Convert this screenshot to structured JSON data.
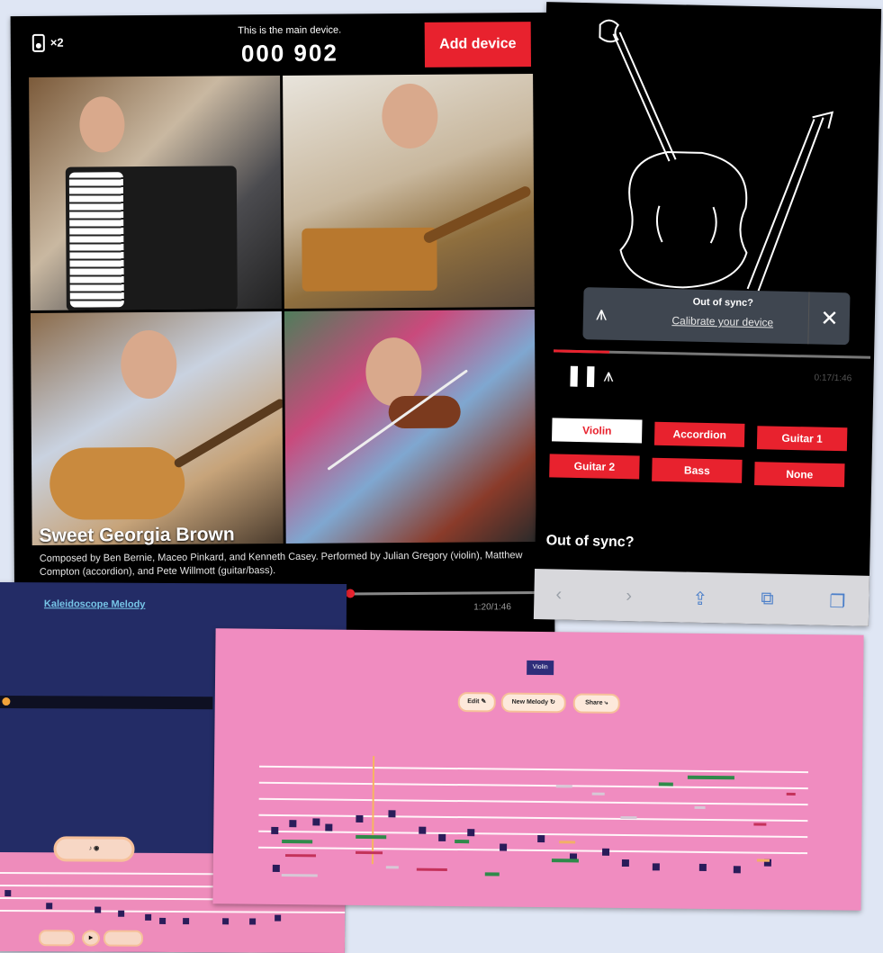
{
  "tablet": {
    "speaker_count": "×2",
    "main_device_label": "This is the main device.",
    "device_code": "000 902",
    "add_device_label": "Add device",
    "song_title": "Sweet Georgia Brown",
    "credits": "Composed by Ben Bernie, Maceo Pinkard, and Kenneth Casey. Performed by Julian Gregory (violin), Matthew Compton (accordion), and Pete Willmott (guitar/bass).",
    "time": "1:20/1:46",
    "icons": {
      "speaker": "speaker-icon"
    }
  },
  "phone": {
    "sync_question": "Out of sync?",
    "calibrate_link": "Calibrate your device",
    "time": "0:17/1:46",
    "parts": [
      "Violin",
      "Accordion",
      "Guitar 1",
      "Guitar 2",
      "Bass",
      "None"
    ],
    "selected_part": "Violin",
    "out_of_sync_heading": "Out of sync?",
    "browser_icons": [
      "back-icon",
      "forward-icon",
      "share-icon",
      "bookmarks-icon",
      "tabs-icon"
    ]
  },
  "melody": {
    "title": "Kaleidoscope Melody"
  },
  "editor": {
    "badge": "Violin",
    "edit_label": "Edit ✎",
    "new_melody_label": "New Melody ↻",
    "share_label": "Share ⤷"
  },
  "colors": {
    "accent_red": "#e8222e",
    "navy": "#232c66",
    "pink": "#f08cc0"
  }
}
